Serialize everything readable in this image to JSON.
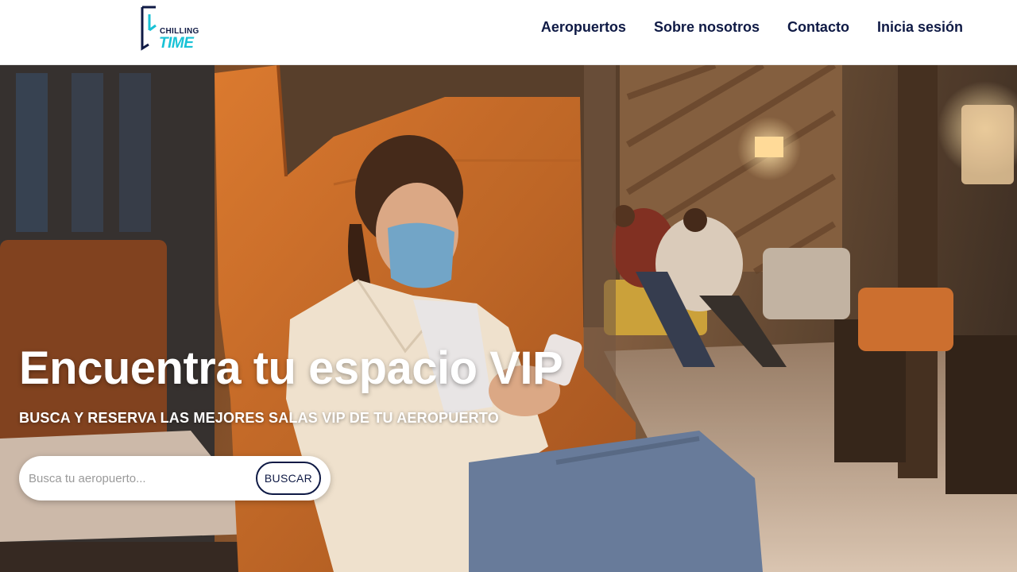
{
  "brand": {
    "line1": "CHILLING",
    "line2": "TIME",
    "colors": {
      "dark": "#0f1a45",
      "accent": "#19c2d6"
    }
  },
  "nav": {
    "items": [
      "Aeropuertos",
      "Sobre nosotros",
      "Contacto",
      "Inicia sesión"
    ]
  },
  "hero": {
    "title": "Encuentra tu espacio VIP",
    "subtitle": "BUSCA Y RESERVA LAS MEJORES SALAS VIP DE TU AEROPUERTO",
    "image": "woman-in-airport-vip-lounge-photo"
  },
  "search": {
    "placeholder": "Busca tu aeropuerto...",
    "value": "",
    "button_label": "BUSCAR"
  }
}
